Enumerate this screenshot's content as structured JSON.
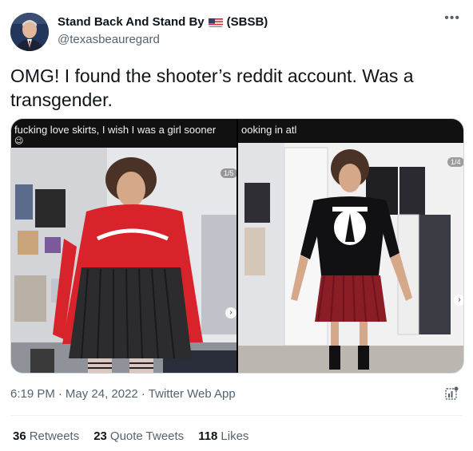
{
  "author": {
    "display_name_part1": "Stand Back And Stand By",
    "display_name_part2": "(SBSB)",
    "handle": "@texasbeauregard",
    "flag_icon": "us-flag-icon"
  },
  "tweet": {
    "text": "OMG! I found the shooter’s reddit account. Was a transgender."
  },
  "media": {
    "image1": {
      "caption": "fucking love skirts, I wish I was a girl sooner",
      "counter": "1/5",
      "emoji": "😉"
    },
    "image2": {
      "caption": "ooking in atl",
      "counter": "1/4"
    }
  },
  "meta": {
    "time": "6:19 PM",
    "date": "May 24, 2022",
    "source": "Twitter Web App",
    "separator": "·"
  },
  "stats": {
    "retweets_count": "36",
    "retweets_label": "Retweets",
    "quotes_count": "23",
    "quotes_label": "Quote Tweets",
    "likes_count": "118",
    "likes_label": "Likes"
  },
  "colors": {
    "text_primary": "#0f1419",
    "text_secondary": "#536471",
    "border": "#cfd9de"
  }
}
